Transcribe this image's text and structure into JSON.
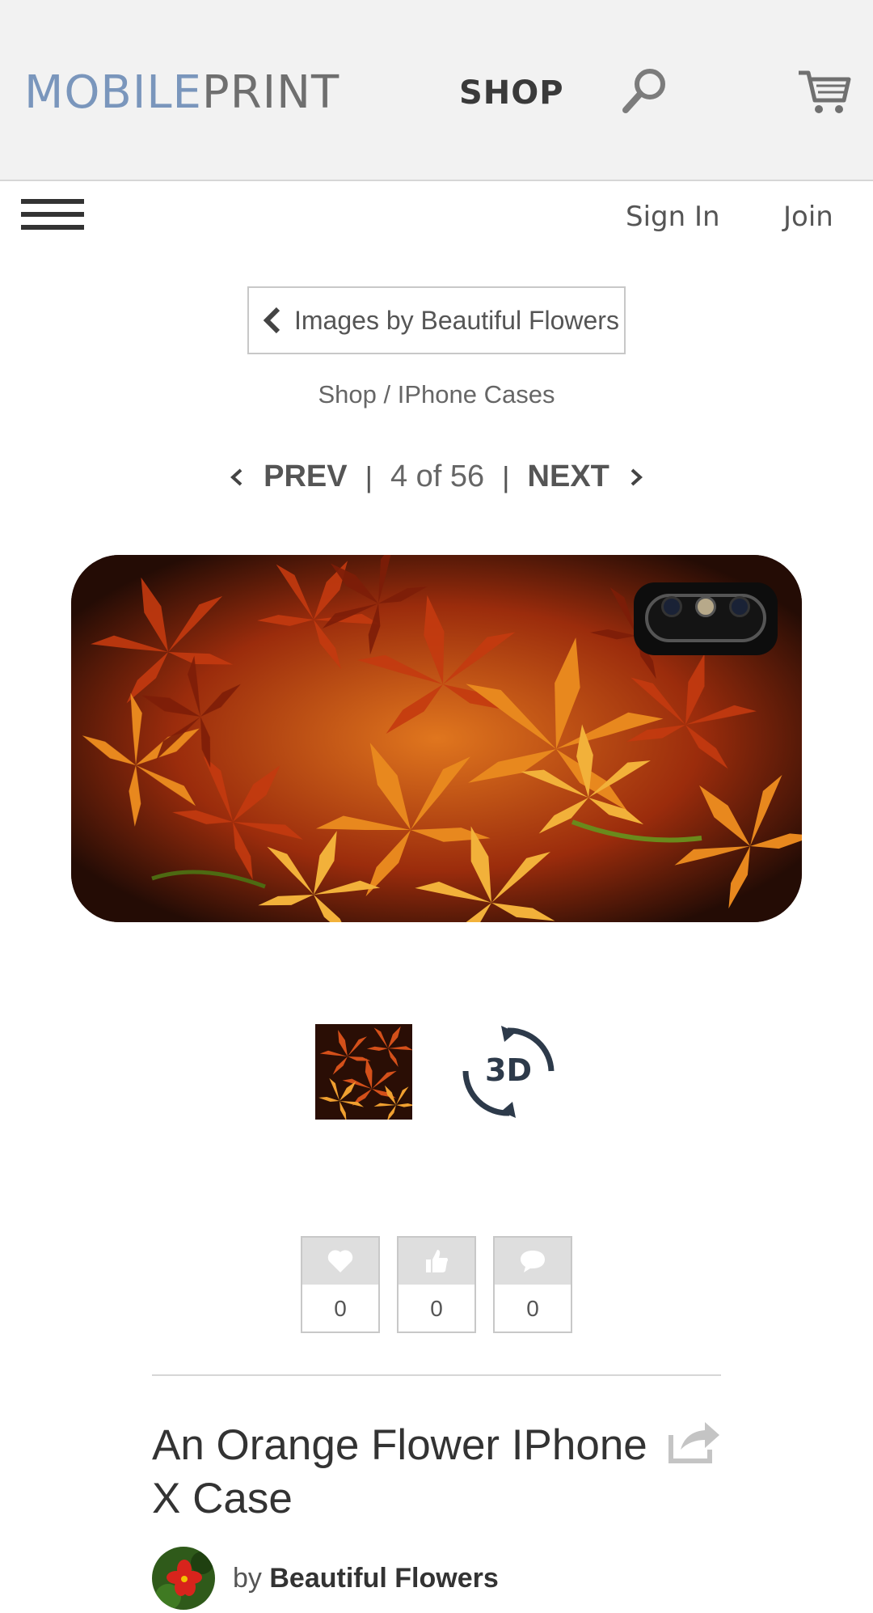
{
  "header": {
    "logo_part1": "MOBILE",
    "logo_part2": "PRINT",
    "shop_label": "SHOP",
    "search_icon": "search-icon",
    "cart_icon": "cart-icon"
  },
  "nav": {
    "menu_icon": "hamburger-icon",
    "sign_in": "Sign In",
    "join": "Join"
  },
  "back_link": {
    "label": "Images by Beautiful Flowers"
  },
  "breadcrumb": {
    "shop": "Shop",
    "separator": " / ",
    "category": "IPhone Cases"
  },
  "pager": {
    "prev": "PREV",
    "separator": "|",
    "position": "4 of 56",
    "next": "NEXT"
  },
  "product": {
    "title": "An Orange Flower IPhone X Case",
    "by_label": "by",
    "artist": "Beautiful Flowers",
    "view_3d_label": "3D"
  },
  "stats": {
    "likes": "0",
    "thumbs_up": "0",
    "comments": "0"
  },
  "colors": {
    "logo_blue": "#7a96bc",
    "header_bg": "#f2f2f2",
    "text_dark": "#333333"
  }
}
